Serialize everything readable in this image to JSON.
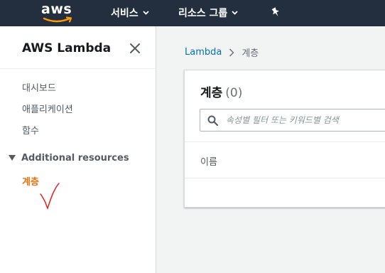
{
  "topnav": {
    "logo_text": "aws",
    "services_label": "서비스",
    "resource_groups_label": "리소스 그룹",
    "brand_color": "#232f3e",
    "accent_color": "#ff9900"
  },
  "sidebar": {
    "title": "AWS Lambda",
    "items": [
      {
        "label": "대시보드"
      },
      {
        "label": "애플리케이션"
      },
      {
        "label": "함수"
      }
    ],
    "section": {
      "label": "Additional resources"
    },
    "active_item": {
      "label": "계층",
      "color": "#ec7211"
    }
  },
  "breadcrumb": {
    "root": "Lambda",
    "current": "계층"
  },
  "panel": {
    "title": "계층",
    "count": "(0)",
    "search_placeholder": "속성별 필터 또는 키워드별 검색",
    "search_value": "",
    "column_header": "이름"
  }
}
